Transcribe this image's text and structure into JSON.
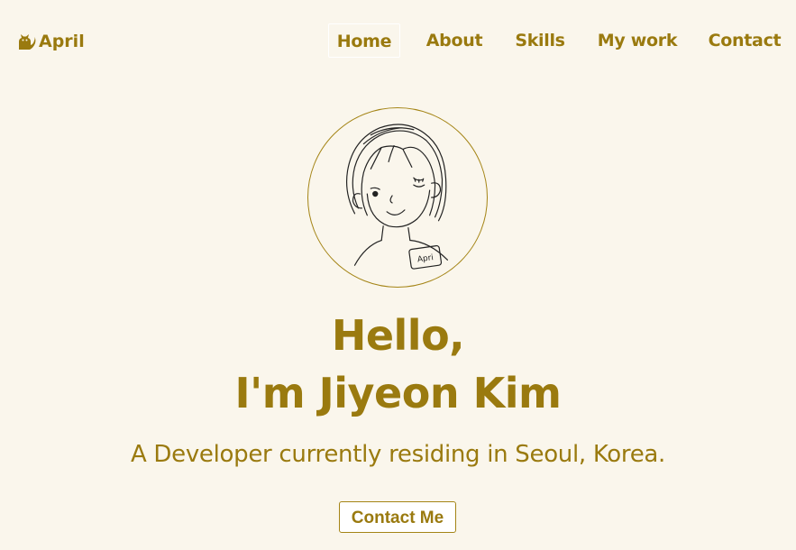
{
  "navbar": {
    "logo": {
      "icon": "cat-icon",
      "label": "April"
    },
    "items": [
      {
        "label": "Home",
        "active": true
      },
      {
        "label": "About",
        "active": false
      },
      {
        "label": "Skills",
        "active": false
      },
      {
        "label": "My work",
        "active": false
      },
      {
        "label": "Contact",
        "active": false
      }
    ]
  },
  "home": {
    "avatar": {
      "badge_text": "April"
    },
    "title_line1": "Hello,",
    "title_line2": "I'm Jiyeon Kim",
    "subtitle": "A Developer currently residing in Seoul, Korea.",
    "contact_button": "Contact Me"
  },
  "colors": {
    "background": "#faf6ec",
    "accent": "#9a7a0f",
    "border": "#a48415"
  }
}
